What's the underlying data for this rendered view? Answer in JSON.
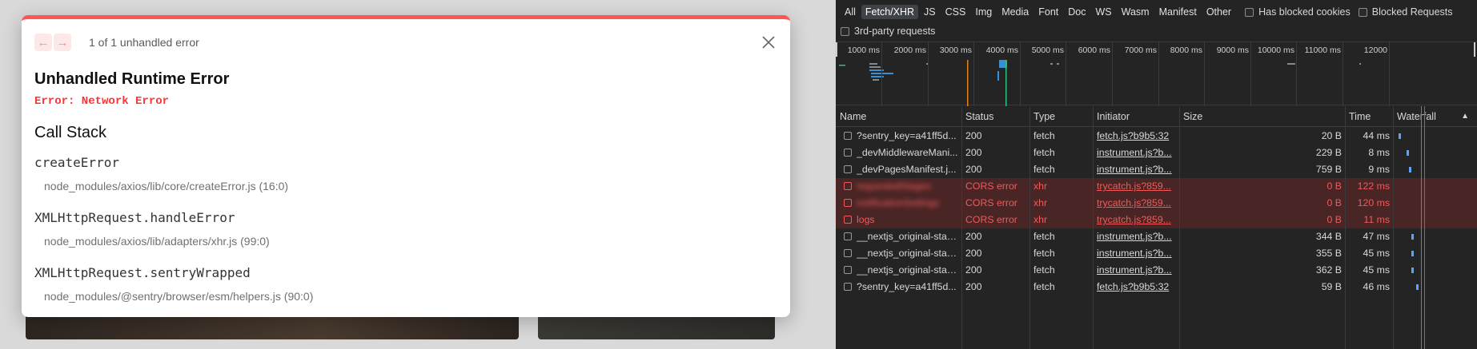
{
  "overlay": {
    "nav_prev_label": "←",
    "nav_next_label": "→",
    "count_text": "1 of 1 unhandled error",
    "title": "Unhandled Runtime Error",
    "message": "Error: Network Error",
    "call_stack_title": "Call Stack",
    "frames": [
      {
        "fn": "createError",
        "file": "node_modules/axios/lib/core/createError.js (16:0)"
      },
      {
        "fn": "XMLHttpRequest.handleError",
        "file": "node_modules/axios/lib/adapters/xhr.js (99:0)"
      },
      {
        "fn": "XMLHttpRequest.sentryWrapped",
        "file": "node_modules/@sentry/browser/esm/helpers.js (90:0)"
      }
    ],
    "accent_color": "#ff5555"
  },
  "devtools": {
    "filter_types": [
      "All",
      "Fetch/XHR",
      "JS",
      "CSS",
      "Img",
      "Media",
      "Font",
      "Doc",
      "WS",
      "Wasm",
      "Manifest",
      "Other"
    ],
    "active_filter": "Fetch/XHR",
    "has_blocked_cookies_label": "Has blocked cookies",
    "blocked_requests_label": "Blocked Requests",
    "third_party_label": "3rd-party requests",
    "timeline_ticks": [
      "1000 ms",
      "2000 ms",
      "3000 ms",
      "4000 ms",
      "5000 ms",
      "6000 ms",
      "7000 ms",
      "8000 ms",
      "9000 ms",
      "10000 ms",
      "11000 ms",
      "12000"
    ],
    "columns": {
      "name": "Name",
      "status": "Status",
      "type": "Type",
      "initiator": "Initiator",
      "size": "Size",
      "time": "Time",
      "waterfall": "Waterfall",
      "sort_icon": "▲"
    },
    "error_color": "#f05a5a",
    "requests": [
      {
        "name": "?sentry_key=a41ff5d...",
        "status": "200",
        "type": "fetch",
        "initiator": "fetch.js?b9b5:32",
        "size": "20 B",
        "time": "44 ms",
        "error": false,
        "blurred": false
      },
      {
        "name": "_devMiddlewareMani...",
        "status": "200",
        "type": "fetch",
        "initiator": "instrument.js?b...",
        "size": "229 B",
        "time": "8 ms",
        "error": false,
        "blurred": false
      },
      {
        "name": "_devPagesManifest.j...",
        "status": "200",
        "type": "fetch",
        "initiator": "instrument.js?b...",
        "size": "759 B",
        "time": "9 ms",
        "error": false,
        "blurred": false
      },
      {
        "name": "requestedStages",
        "status": "CORS error",
        "type": "xhr",
        "initiator": "trycatch.js?859...",
        "size": "0 B",
        "time": "122 ms",
        "error": true,
        "blurred": true
      },
      {
        "name": "notificationSettings",
        "status": "CORS error",
        "type": "xhr",
        "initiator": "trycatch.js?859...",
        "size": "0 B",
        "time": "120 ms",
        "error": true,
        "blurred": true
      },
      {
        "name": "logs",
        "status": "CORS error",
        "type": "xhr",
        "initiator": "trycatch.js?859...",
        "size": "0 B",
        "time": "11 ms",
        "error": true,
        "blurred": false
      },
      {
        "name": "__nextjs_original-stac...",
        "status": "200",
        "type": "fetch",
        "initiator": "instrument.js?b...",
        "size": "344 B",
        "time": "47 ms",
        "error": false,
        "blurred": false
      },
      {
        "name": "__nextjs_original-stac...",
        "status": "200",
        "type": "fetch",
        "initiator": "instrument.js?b...",
        "size": "355 B",
        "time": "45 ms",
        "error": false,
        "blurred": false
      },
      {
        "name": "__nextjs_original-stac...",
        "status": "200",
        "type": "fetch",
        "initiator": "instrument.js?b...",
        "size": "362 B",
        "time": "45 ms",
        "error": false,
        "blurred": false
      },
      {
        "name": "?sentry_key=a41ff5d...",
        "status": "200",
        "type": "fetch",
        "initiator": "fetch.js?b9b5:32",
        "size": "59 B",
        "time": "46 ms",
        "error": false,
        "blurred": false
      }
    ]
  }
}
